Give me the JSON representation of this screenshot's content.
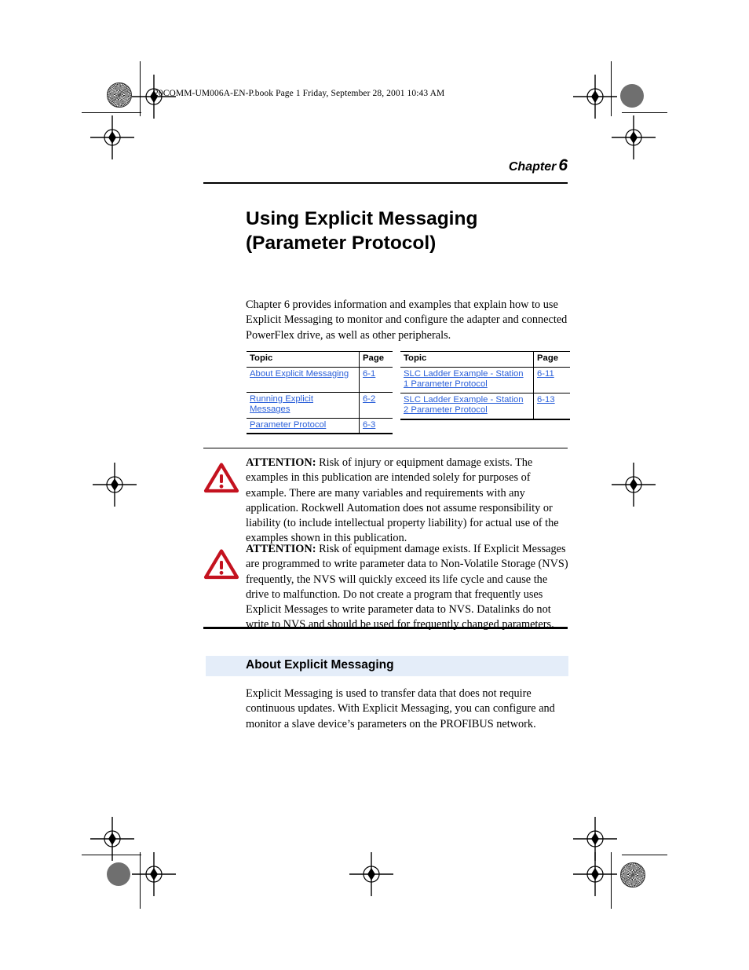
{
  "page": {
    "filename_header": "20COMM-UM006A-EN-P.book  Page 1  Friday, September 28, 2001  10:43 AM",
    "chapter_label": "Chapter",
    "chapter_number": "6",
    "chapter_title_line1": "Using Explicit Messaging",
    "chapter_title_line2": "(Parameter Protocol)",
    "intro_paragraph": "Chapter 6 provides information and examples that explain how to use Explicit Messaging to monitor and configure the adapter and connected PowerFlex drive, as well as other peripherals."
  },
  "topic_tables": {
    "left": {
      "headers": [
        "Topic",
        "Page"
      ],
      "rows": [
        {
          "topic": "About Explicit Messaging",
          "page": "6-1"
        },
        {
          "topic": "Running Explicit Messages",
          "page": "6-2"
        },
        {
          "topic": "Parameter Protocol",
          "page": "6-3"
        }
      ]
    },
    "right": {
      "headers": [
        "Topic",
        "Page"
      ],
      "rows": [
        {
          "topic": "SLC Ladder Example - Station 1 Parameter Protocol",
          "page": "6-11"
        },
        {
          "topic": "SLC Ladder Example - Station 2 Parameter Protocol",
          "page": "6-13"
        }
      ]
    }
  },
  "attention_blocks": [
    {
      "label": "ATTENTION:",
      "text": " Risk of injury or equipment damage exists. The examples in this publication are intended solely for purposes of example. There are many variables and requirements with any application. Rockwell Automation does not assume responsibility or liability (to include intellectual property liability) for actual use of the examples shown in this publication."
    },
    {
      "label": "ATTENTION:",
      "text": " Risk of equipment damage exists. If Explicit Messages are programmed to write parameter data to Non-Volatile Storage (NVS) frequently, the NVS will quickly exceed its life cycle and cause the drive to malfunction. Do not create a program that frequently uses Explicit Messages to write parameter data to NVS. Datalinks do not write to NVS and should be used for frequently changed parameters."
    }
  ],
  "section": {
    "heading": "About Explicit Messaging",
    "paragraph": "Explicit Messaging is used to transfer data that does not require continuous updates. With Explicit Messaging, you can configure and monitor a slave device’s parameters on the PROFIBUS network."
  },
  "colors": {
    "link": "#2a5fd9",
    "section_bar": "#e4edf9",
    "warning_red": "#c4121f",
    "rule": "#000000"
  }
}
